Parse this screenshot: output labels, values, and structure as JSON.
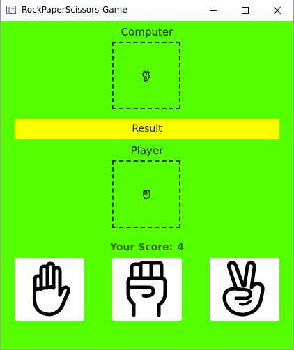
{
  "window": {
    "title": "RockPaperScissors-Game",
    "icons": {
      "app": "app-window-icon",
      "minimize": "minimize-icon",
      "maximize": "maximize-icon",
      "close": "close-icon"
    }
  },
  "game": {
    "computer_label": "Computer",
    "computer_choice_icon": "scissors-small-icon",
    "result_label": "Result",
    "player_label": "Player",
    "player_choice_icon": "rock-small-icon",
    "score_label": "Your Score:",
    "score_value": "4",
    "choices": [
      {
        "name": "paper",
        "icon": "paper-hand-icon"
      },
      {
        "name": "rock",
        "icon": "rock-fist-icon"
      },
      {
        "name": "scissors",
        "icon": "scissors-hand-icon"
      }
    ]
  },
  "colors": {
    "background": "#54ff00",
    "result_bar": "#ffff00",
    "score_text": "#3d6b14",
    "choice_card": "#ffffff"
  }
}
